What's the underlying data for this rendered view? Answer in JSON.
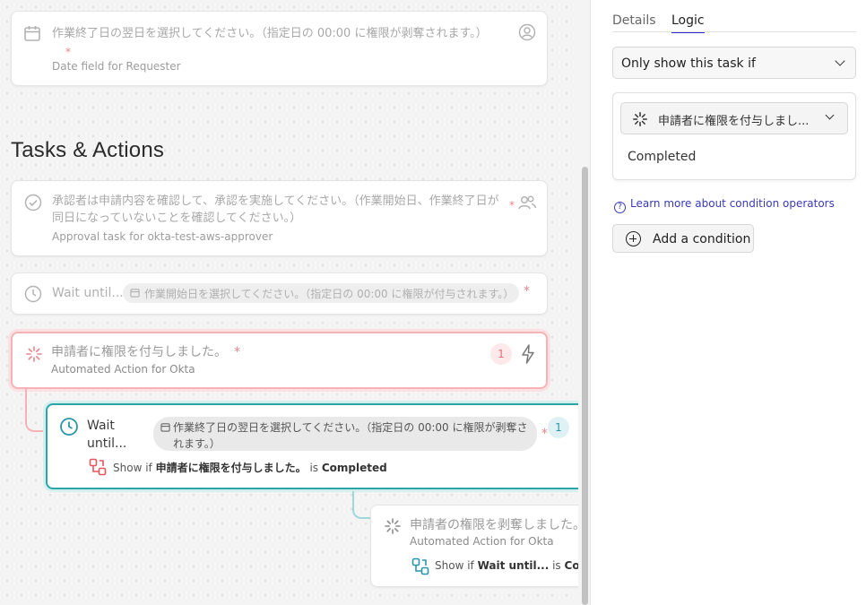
{
  "canvas": {
    "date_card": {
      "prompt": "作業終了日の翌日を選択してください。（指定日の 00:00 に権限が剥奪されます。）",
      "required": "*",
      "subtitle": "Date field for Requester"
    },
    "section_title": "Tasks & Actions",
    "approval_card": {
      "prompt": "承認者は申請内容を確認して、承認を実施してください。（作業開始日、作業終了日が同日になっていないことを確認してください。）",
      "required": "*",
      "subtitle": "Approval task for okta-test-aws-approver"
    },
    "wait_card_1": {
      "label": "Wait until...",
      "date_pill": "作業開始日を選択してください。（指定日の 00:00 に権限が付与されます。）",
      "required": "*"
    },
    "okta_grant_card": {
      "title": "申請者に権限を付与しました。",
      "required": "*",
      "subtitle": "Automated Action for Okta",
      "badge": "1"
    },
    "wait_card_2": {
      "label": "Wait until...",
      "date_pill": "作業終了日の翌日を選択してください。（指定日の 00:00 に権限が剥奪されます。）",
      "required": "*",
      "badge": "1",
      "show_if": "Show if",
      "condition_task": "申請者に権限を付与しました。",
      "is": "is",
      "condition_value": "Completed"
    },
    "okta_revoke_card": {
      "title": "申請者の権限を剥奪しました。",
      "subtitle": "Automated Action for Okta",
      "show_if": "Show if",
      "condition_task": "Wait until...",
      "is": "is",
      "condition_value": "Comp"
    }
  },
  "panel": {
    "tabs": [
      {
        "label": "Details",
        "active": false
      },
      {
        "label": "Logic",
        "active": true
      }
    ],
    "logic_mode": "Only show this task if",
    "condition": {
      "task": "申請者に権限を付与しまし...",
      "value": "Completed"
    },
    "learn_link": "Learn more about condition operators",
    "add_condition": "Add a condition"
  },
  "colors": {
    "accent_blue": "#2b2bd6",
    "teal": "#2aa6a6",
    "required_red": "#e8828a"
  }
}
